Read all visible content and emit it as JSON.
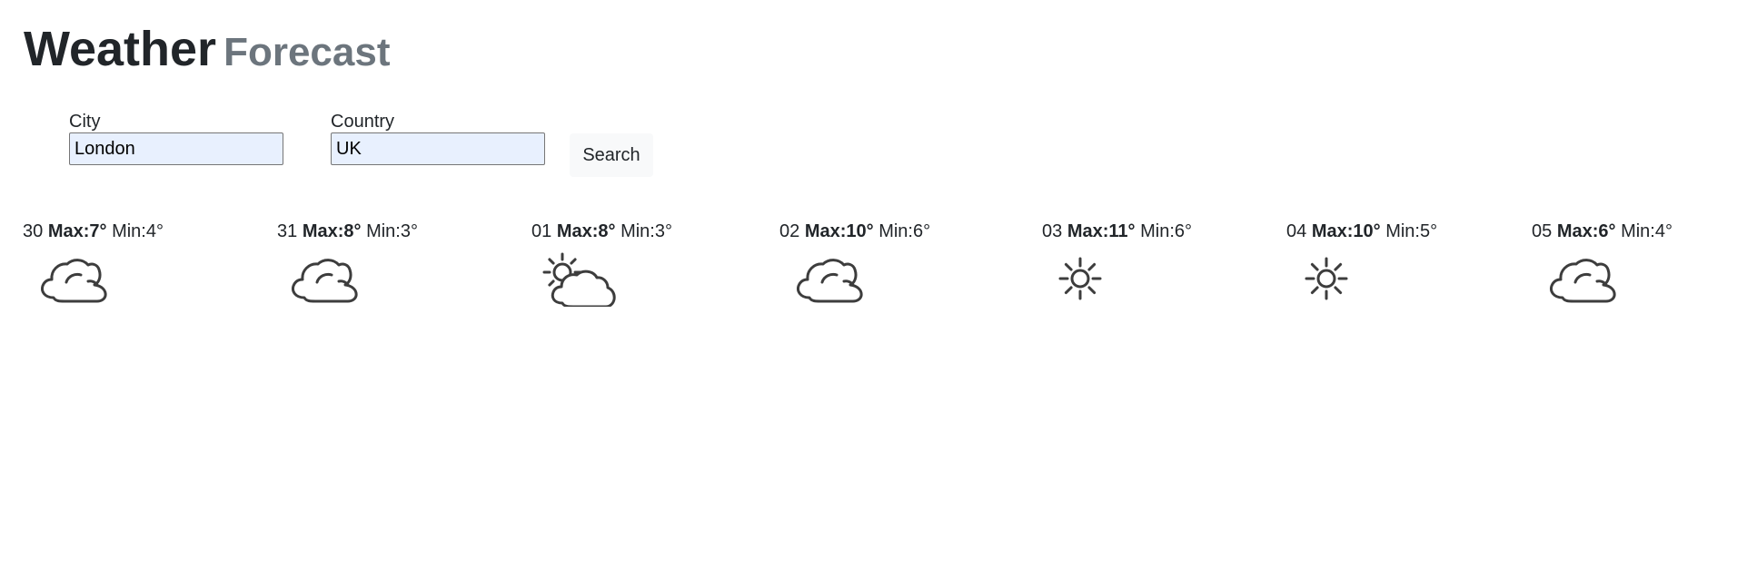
{
  "header": {
    "title": "Weather",
    "subtitle": "Forecast"
  },
  "form": {
    "city_label": "City",
    "city_value": "London",
    "country_label": "Country",
    "country_value": "UK",
    "search_label": "Search"
  },
  "forecast": [
    {
      "date": "30",
      "max_label": "Max:7°",
      "min_label": "Min:4°",
      "icon": "cloudy-icon"
    },
    {
      "date": "31",
      "max_label": "Max:8°",
      "min_label": "Min:3°",
      "icon": "cloudy-icon"
    },
    {
      "date": "01",
      "max_label": "Max:8°",
      "min_label": "Min:3°",
      "icon": "partly-cloudy-icon"
    },
    {
      "date": "02",
      "max_label": "Max:10°",
      "min_label": "Min:6°",
      "icon": "cloudy-icon"
    },
    {
      "date": "03",
      "max_label": "Max:11°",
      "min_label": "Min:6°",
      "icon": "sunny-icon"
    },
    {
      "date": "04",
      "max_label": "Max:10°",
      "min_label": "Min:5°",
      "icon": "sunny-icon"
    },
    {
      "date": "05",
      "max_label": "Max:6°",
      "min_label": "Min:4°",
      "icon": "cloudy-icon"
    }
  ]
}
